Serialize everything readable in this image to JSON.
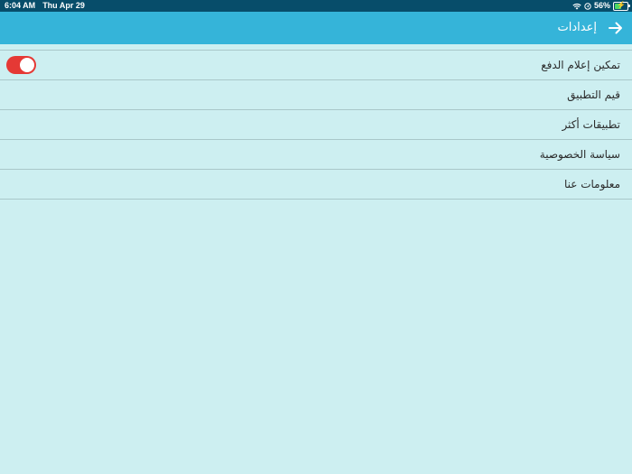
{
  "status_bar": {
    "time": "6:04 AM",
    "date": "Thu Apr 29",
    "battery": "56%",
    "battery_level": 0.56,
    "icons": [
      "wifi-icon",
      "location-icon",
      "battery-icon",
      "charging-icon"
    ]
  },
  "header": {
    "title": "إعدادات",
    "back_icon": "arrow-right-icon"
  },
  "settings": {
    "items": [
      {
        "label": "تمكين إعلام الدفع",
        "toggle_on": true
      },
      {
        "label": "قيم التطبيق"
      },
      {
        "label": "تطبيقات أكثر"
      },
      {
        "label": "سياسة الخصوصية"
      },
      {
        "label": "معلومات عنا"
      }
    ]
  },
  "colors": {
    "status_bar": "#074d6a",
    "header": "#35b4d9",
    "background": "#cdeff1",
    "divider": "#a9c7c9",
    "toggle_on": "#e53935",
    "battery_fill": "#4cd964"
  }
}
